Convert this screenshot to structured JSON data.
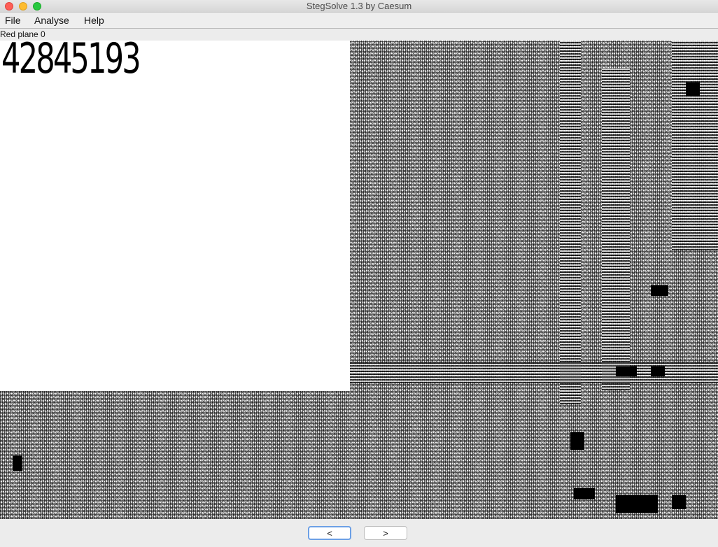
{
  "window": {
    "title": "StegSolve 1.3 by Caesum"
  },
  "menu": {
    "file": "File",
    "analyse": "Analyse",
    "help": "Help"
  },
  "view": {
    "plane_label": "Red plane 0",
    "hidden_text": "42845193"
  },
  "navigation": {
    "prev_label": "<",
    "next_label": ">"
  },
  "colors": {
    "close": "#fe5f57",
    "minimize": "#febc2e",
    "maximize": "#28c840",
    "focus_ring": "#6ca0e6"
  }
}
